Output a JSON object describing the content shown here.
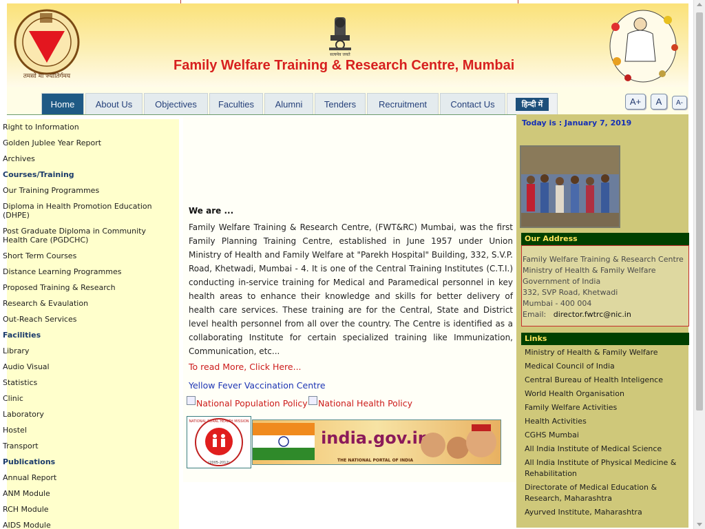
{
  "colors": {
    "title_red": "#d7201f",
    "nav_active": "#1f5a85",
    "left_bg": "#ffffcc",
    "right_bg": "#cfc87a",
    "box_heading_bg": "#004000",
    "box_heading_text": "#ffe35a",
    "link_red": "#cc1b1b",
    "link_blue": "#1c34b4"
  },
  "header": {
    "title": "Family Welfare Training & Research Centre, Mumbai",
    "logo_left_motto": "तमसो मा ज्योतिर्गमय",
    "emblem_caption": "सत्यमेव जयते"
  },
  "nav": {
    "tabs": [
      "Home",
      "About Us",
      "Objectives",
      "Faculties",
      "Alumni",
      "Tenders",
      "Recruitment",
      "Contact Us"
    ],
    "hindi_label": "हिन्दी में",
    "font_buttons": [
      "A+",
      "A",
      "A-"
    ]
  },
  "left_menu": [
    {
      "label": "Right to Information",
      "heading": false
    },
    {
      "label": "Golden Jublee Year Report",
      "heading": false
    },
    {
      "label": "Archives",
      "heading": false
    },
    {
      "label": "Courses/Training",
      "heading": true
    },
    {
      "label": "Our Training Programmes",
      "heading": false
    },
    {
      "label": "Diploma in Health Promotion Education (DHPE)",
      "heading": false
    },
    {
      "label": "Post Graduate Diploma in Community Health Care (PGDCHC)",
      "heading": false
    },
    {
      "label": "Short Term Courses",
      "heading": false
    },
    {
      "label": "Distance Learning Programmes",
      "heading": false
    },
    {
      "label": "Proposed Training & Research",
      "heading": false
    },
    {
      "label": "Research & Evaulation",
      "heading": false
    },
    {
      "label": "Out-Reach Services",
      "heading": false
    },
    {
      "label": "Facilities",
      "heading": true
    },
    {
      "label": "Library",
      "heading": false
    },
    {
      "label": "Audio Visual",
      "heading": false
    },
    {
      "label": "Statistics",
      "heading": false
    },
    {
      "label": "Clinic",
      "heading": false
    },
    {
      "label": "Laboratory",
      "heading": false
    },
    {
      "label": "Hostel",
      "heading": false
    },
    {
      "label": "Transport",
      "heading": false
    },
    {
      "label": "Publications",
      "heading": true
    },
    {
      "label": "Annual Report",
      "heading": false
    },
    {
      "label": "ANM Module",
      "heading": false
    },
    {
      "label": "RCH Module",
      "heading": false
    },
    {
      "label": "AIDS Module",
      "heading": false
    }
  ],
  "main": {
    "we_are": "We are ...",
    "intro": "Family Welfare Training & Research Centre, (FWT&RC) Mumbai, was the first Family Planning Training Centre, established in June 1957 under Union Ministry of Health and Family Welfare at \"Parekh Hospital\" Building, 332, S.V.P. Road, Khetwadi, Mumbai - 4. It is one of the Central Training Institutes (C.T.I.) conducting in-service training for Medical and Paramedical personnel in key health areas to enhance their knowledge and skills for better delivery of health care services. These training are for the Central, State and District level health personnel from all over the country. The Centre is identified as a collaborating Institute for certain specialized training like Immunization, Communication, etc...",
    "read_more": "To read More, Click Here...",
    "yellow_fever": "Yellow Fever Vaccination Centre",
    "policy_links": [
      "National Population Policy",
      "National Health Policy"
    ],
    "nrhm_text": "NATIONAL RURAL HEALTH MISSION",
    "nrhm_years": "(2005-2012)",
    "india_gov_brand": "india.gov.in",
    "india_gov_tagline": "THE NATIONAL PORTAL OF INDIA"
  },
  "right": {
    "today": "Today is : January 7, 2019",
    "address_heading": "Our Address",
    "address_lines": [
      "Family Welfare Training & Research Centre",
      "Ministry of Health & Family Welfare",
      "Government of India",
      "332, SVP Road, Khetwadi",
      "Mumbai - 400 004"
    ],
    "email_label": "Email:",
    "email_value": "director.fwtrc@nic.in",
    "links_heading": "Links",
    "links": [
      "Ministry of Health & Family Welfare",
      "Medical Council of India",
      "Central Bureau of Health Inteligence",
      "World Health Organisation",
      "Family Welfare Activities",
      "Health Activities",
      "CGHS Mumbai",
      "All India Institute of Medical Science",
      "All India Institute of Physical Medicine & Rehabilitation",
      "Directorate of Medical Education & Research, Maharashtra",
      "Ayurved Institute, Maharashtra"
    ]
  }
}
